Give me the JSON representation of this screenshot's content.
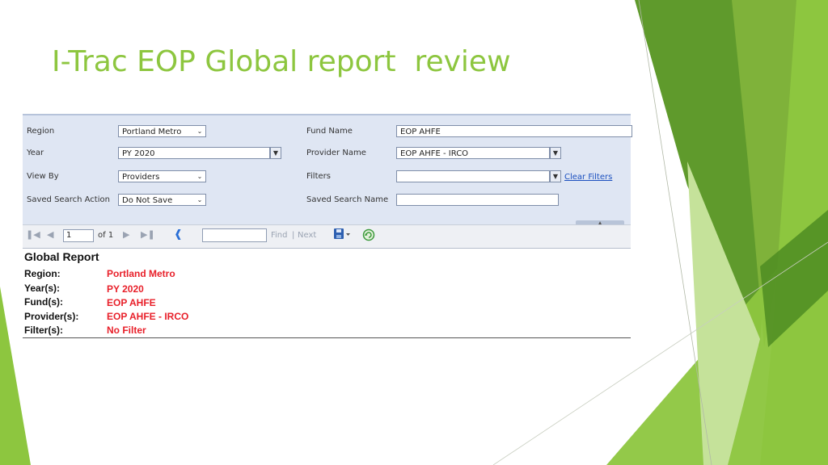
{
  "slide": {
    "title": "I-Trac EOP Global report  review",
    "accent_color": "#8dc63f"
  },
  "parameters": {
    "region_label": "Region",
    "region_value": "Portland Metro",
    "year_label": "Year",
    "year_value": "PY 2020",
    "view_by_label": "View By",
    "view_by_value": "Providers",
    "saved_search_action_label": "Saved Search Action",
    "saved_search_action_value": "Do Not Save",
    "fund_name_label": "Fund Name",
    "fund_name_value": "EOP AHFE",
    "provider_name_label": "Provider Name",
    "provider_name_value": "EOP AHFE - IRCO",
    "filters_label": "Filters",
    "filters_value": "",
    "clear_filters_label": "Clear Filters",
    "saved_search_name_label": "Saved Search Name",
    "saved_search_name_value": ""
  },
  "toolbar": {
    "page_value": "1",
    "of_text": "of 1",
    "find_label": "Find",
    "separator": "|",
    "next_label": "Next",
    "icons": [
      "first-page-icon",
      "prev-page-icon",
      "next-page-icon",
      "last-page-icon",
      "back-icon",
      "export-save-icon",
      "refresh-icon"
    ]
  },
  "report": {
    "title": "Global Report",
    "rows": [
      {
        "label": "Region:",
        "value": "Portland Metro"
      },
      {
        "label": "Year(s):",
        "value": "PY 2020"
      },
      {
        "label": "Fund(s):",
        "value": "EOP AHFE"
      },
      {
        "label": "Provider(s):",
        "value": "EOP AHFE - IRCO"
      },
      {
        "label": "Filter(s):",
        "value": "No Filter"
      }
    ],
    "value_color": "#e8202a"
  }
}
